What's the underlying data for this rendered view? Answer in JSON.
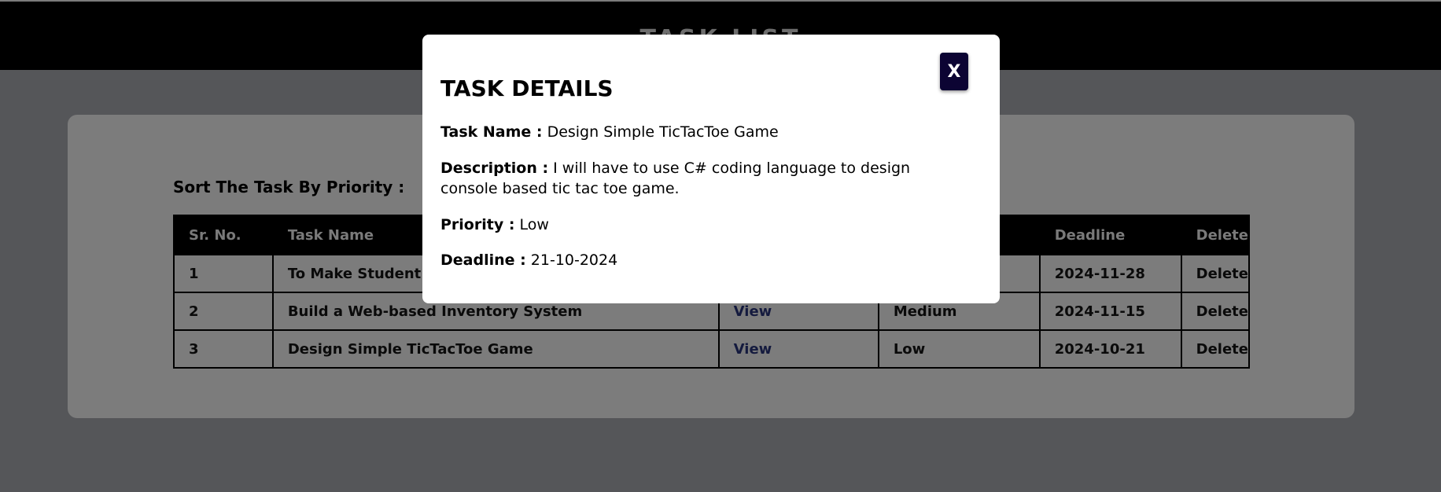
{
  "header": {
    "title": "TASK LIST"
  },
  "main": {
    "sort_label": "Sort The Task By Priority :",
    "columns": [
      "Sr. No.",
      "Task Name",
      "",
      "",
      "Deadline",
      "Delete"
    ],
    "rows": [
      {
        "sr": "1",
        "name": "To Make Student CRUD",
        "view": "",
        "priority": "",
        "deadline": "2024-11-28",
        "delete": "Delete"
      },
      {
        "sr": "2",
        "name": "Build a Web-based Inventory System",
        "view": "View",
        "priority": "Medium",
        "deadline": "2024-11-15",
        "delete": "Delete"
      },
      {
        "sr": "3",
        "name": "Design Simple TicTacToe Game",
        "view": "View",
        "priority": "Low",
        "deadline": "2024-10-21",
        "delete": "Delete"
      }
    ]
  },
  "modal": {
    "close_label": "X",
    "title": "TASK DETAILS",
    "task_name_label": "Task Name :",
    "task_name_value": "Design Simple TicTacToe Game",
    "description_label": "Description :",
    "description_value": "I will have to use C# coding language to design console based tic tac toe game.",
    "priority_label": "Priority :",
    "priority_value": "Low",
    "deadline_label": "Deadline :",
    "deadline_value": "21-10-2024"
  },
  "colors": {
    "overlay_background": "#555659",
    "header_background": "#000000",
    "card_background": "#7c7c7c",
    "modal_background": "#ffffff",
    "close_button": "#0c0433",
    "view_link": "#141a3e"
  }
}
